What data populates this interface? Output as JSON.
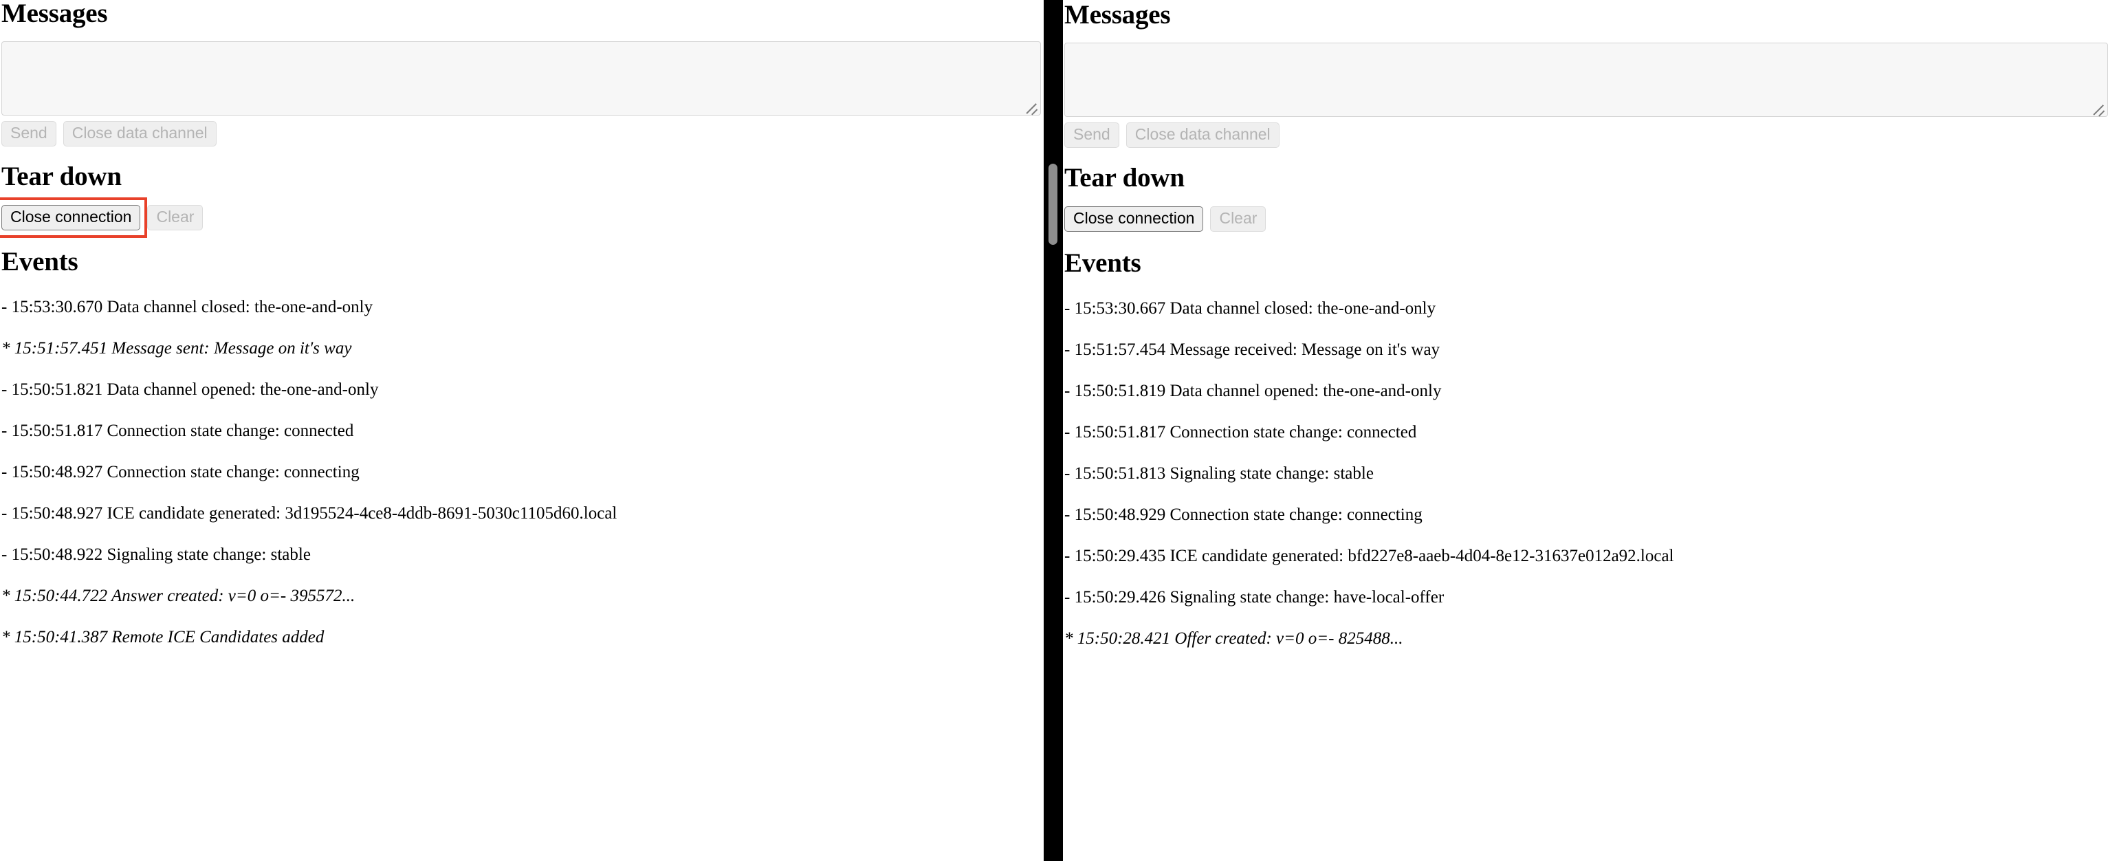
{
  "panes": [
    {
      "id": "left",
      "messages": {
        "heading": "Messages",
        "textarea_value": "",
        "textarea_placeholder": "",
        "send_label": "Send",
        "close_data_channel_label": "Close data channel",
        "send_disabled": true,
        "close_data_channel_disabled": true
      },
      "teardown": {
        "heading": "Tear down",
        "close_connection_label": "Close connection",
        "clear_label": "Clear",
        "close_connection_disabled": false,
        "clear_disabled": true,
        "close_connection_highlighted": true
      },
      "events": {
        "heading": "Events",
        "lines": [
          {
            "text": "- 15:53:30.670 Data channel closed: the-one-and-only",
            "italic": false
          },
          {
            "text": "* 15:51:57.451 Message sent: Message on it's way",
            "italic": true
          },
          {
            "text": "- 15:50:51.821 Data channel opened: the-one-and-only",
            "italic": false
          },
          {
            "text": "- 15:50:51.817 Connection state change: connected",
            "italic": false
          },
          {
            "text": "- 15:50:48.927 Connection state change: connecting",
            "italic": false
          },
          {
            "text": "- 15:50:48.927 ICE candidate generated: 3d195524-4ce8-4ddb-8691-5030c1105d60.local",
            "italic": false
          },
          {
            "text": "- 15:50:48.922 Signaling state change: stable",
            "italic": false
          },
          {
            "text": "* 15:50:44.722 Answer created: v=0 o=- 395572...",
            "italic": true
          },
          {
            "text": "* 15:50:41.387 Remote ICE Candidates added",
            "italic": true
          }
        ]
      }
    },
    {
      "id": "right",
      "messages": {
        "heading": "Messages",
        "textarea_value": "",
        "textarea_placeholder": "",
        "send_label": "Send",
        "close_data_channel_label": "Close data channel",
        "send_disabled": true,
        "close_data_channel_disabled": true
      },
      "teardown": {
        "heading": "Tear down",
        "close_connection_label": "Close connection",
        "clear_label": "Clear",
        "close_connection_disabled": false,
        "clear_disabled": true,
        "close_connection_highlighted": false
      },
      "events": {
        "heading": "Events",
        "lines": [
          {
            "text": "- 15:53:30.667 Data channel closed: the-one-and-only",
            "italic": false
          },
          {
            "text": "- 15:51:57.454 Message received: Message on it's way",
            "italic": false
          },
          {
            "text": "- 15:50:51.819 Data channel opened: the-one-and-only",
            "italic": false
          },
          {
            "text": "- 15:50:51.817 Connection state change: connected",
            "italic": false
          },
          {
            "text": "- 15:50:51.813 Signaling state change: stable",
            "italic": false
          },
          {
            "text": "- 15:50:48.929 Connection state change: connecting",
            "italic": false
          },
          {
            "text": "- 15:50:29.435 ICE candidate generated: bfd227e8-aaeb-4d04-8e12-31637e012a92.local",
            "italic": false
          },
          {
            "text": "- 15:50:29.426 Signaling state change: have-local-offer",
            "italic": false
          },
          {
            "text": "* 15:50:28.421 Offer created: v=0 o=- 825488...",
            "italic": true
          }
        ]
      }
    }
  ],
  "divider": {
    "color": "#000000",
    "scrollbar_thumb_color": "#8f8f8f"
  },
  "highlight": {
    "color": "#e8412a"
  }
}
